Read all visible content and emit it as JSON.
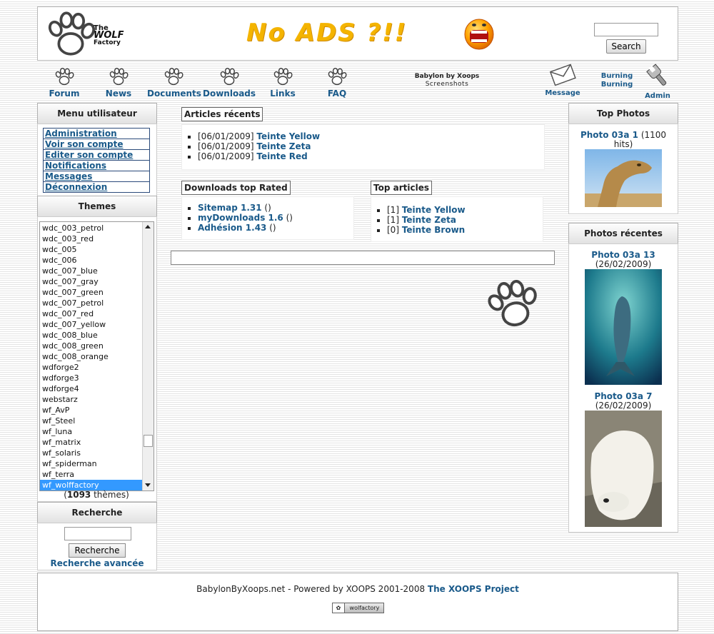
{
  "header": {
    "logo_text_1": "The",
    "logo_text_2": "WOLF",
    "logo_text_3": "Factory",
    "banner_text": "No ADS ?!!",
    "search_button": "Search",
    "search_value": ""
  },
  "nav": {
    "items": [
      {
        "label": "Forum"
      },
      {
        "label": "News"
      },
      {
        "label": "Documents"
      },
      {
        "label": "Downloads"
      },
      {
        "label": "Links"
      },
      {
        "label": "FAQ"
      }
    ],
    "babylon_title": "Babylon by Xoops",
    "babylon_sub": "Screenshots",
    "message_label": "Message",
    "burning_1": "Burning",
    "burning_2": "Burning",
    "admin_label": "Admin"
  },
  "user_menu": {
    "title": "Menu utilisateur",
    "links": [
      "Administration",
      "Voir son compte",
      "Editer son compte",
      "Notifications",
      "Messages",
      "Déconnexion"
    ]
  },
  "themes": {
    "title": "Themes",
    "list": [
      "wdc_003_petrol",
      "wdc_003_red",
      "wdc_005",
      "wdc_006",
      "wdc_007_blue",
      "wdc_007_gray",
      "wdc_007_green",
      "wdc_007_petrol",
      "wdc_007_red",
      "wdc_007_yellow",
      "wdc_008_blue",
      "wdc_008_green",
      "wdc_008_orange",
      "wdforge2",
      "wdforge3",
      "wdforge4",
      "webstarz",
      "wf_AvP",
      "wf_Steel",
      "wf_luna",
      "wf_matrix",
      "wf_solaris",
      "wf_spiderman",
      "wf_terra",
      "wf_wolffactory"
    ],
    "selected": "wf_wolffactory",
    "count_open": "(",
    "count_number": "1093",
    "count_label": " thèmes)"
  },
  "recherche": {
    "title": "Recherche",
    "button": "Recherche",
    "advanced": "Recherche avancée"
  },
  "articles_recents": {
    "title": "Articles récents",
    "items": [
      {
        "date": "[06/01/2009]",
        "title": "Teinte Yellow"
      },
      {
        "date": "[06/01/2009]",
        "title": "Teinte Zeta"
      },
      {
        "date": "[06/01/2009]",
        "title": "Teinte Red"
      }
    ]
  },
  "downloads_top": {
    "title": "Downloads top Rated",
    "items": [
      {
        "name": "Sitemap 1.31",
        "suffix": " ()"
      },
      {
        "name": "myDownloads 1.6",
        "suffix": " ()"
      },
      {
        "name": "Adhésion 1.43",
        "suffix": " ()"
      }
    ]
  },
  "top_articles": {
    "title": "Top articles",
    "items": [
      {
        "count": "[1]",
        "title": "Teinte Yellow"
      },
      {
        "count": "[1]",
        "title": "Teinte Zeta"
      },
      {
        "count": "[0]",
        "title": "Teinte Brown"
      }
    ]
  },
  "top_photos": {
    "title": "Top Photos",
    "caption_link": "Photo 03a 1",
    "caption_rest": " (1100 hits)"
  },
  "photos_recentes": {
    "title": "Photos récentes",
    "items": [
      {
        "link": "Photo 03a 13",
        "rest": " (26/02/2009)"
      },
      {
        "link": "Photo 03a 7",
        "rest": " (26/02/2009)"
      }
    ]
  },
  "footer": {
    "text": "BabylonByXoops.net - Powered by XOOPS 2001-2008 ",
    "link": "The XOOPS Project",
    "badge": "wolfactory"
  }
}
